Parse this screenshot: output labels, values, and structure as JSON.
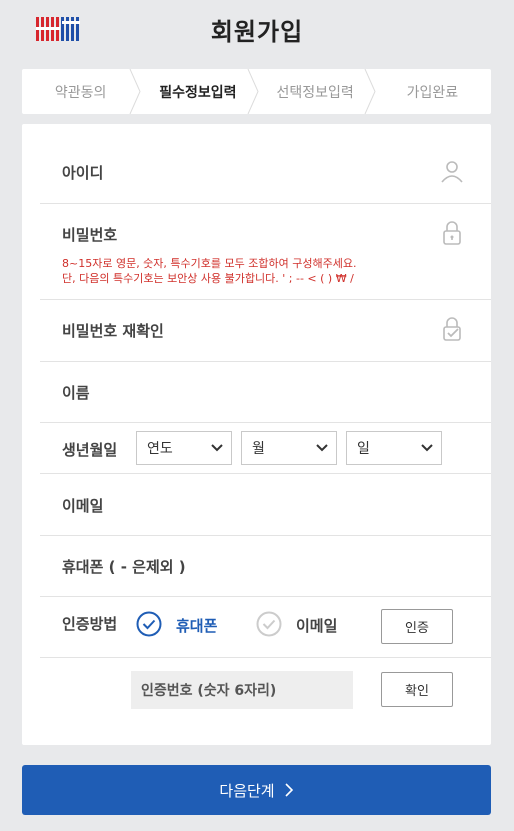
{
  "header": {
    "title": "회원가입",
    "logo_text": "YBM",
    "logo_color": "#d7262d"
  },
  "steps": [
    {
      "label": "약관동의",
      "active": false
    },
    {
      "label": "필수정보입력",
      "active": true
    },
    {
      "label": "선택정보입력",
      "active": false
    },
    {
      "label": "가입완료",
      "active": false
    }
  ],
  "form": {
    "id_label": "아이디",
    "password_label": "비밀번호",
    "password_hint_1": "8~15자로 영문, 숫자, 특수기호를 모두 조합하여 구성해주세요.",
    "password_hint_2": "단, 다음의 특수기호는 보안상 사용 불가합니다. ' ; -- < ( ) ₩ /",
    "password_confirm_label": "비밀번호 재확인",
    "name_label": "이름",
    "birth_label": "생년월일",
    "birth_year": "연도",
    "birth_month": "월",
    "birth_day": "일",
    "email_label": "이메일",
    "phone_label": "휴대폰 ( - 은제외 )",
    "auth_label": "인증방법",
    "auth_option_phone": "휴대폰",
    "auth_option_email": "이메일",
    "auth_selected": "휴대폰",
    "auth_button": "인증",
    "code_placeholder": "인증번호 (숫자 6자리)",
    "confirm_button": "확인"
  },
  "next_button": "다음단계",
  "colors": {
    "primary": "#1f5db5",
    "hint": "#d0302b",
    "radio_checked": "#1f5db5",
    "radio_unchecked": "#cccccc"
  }
}
